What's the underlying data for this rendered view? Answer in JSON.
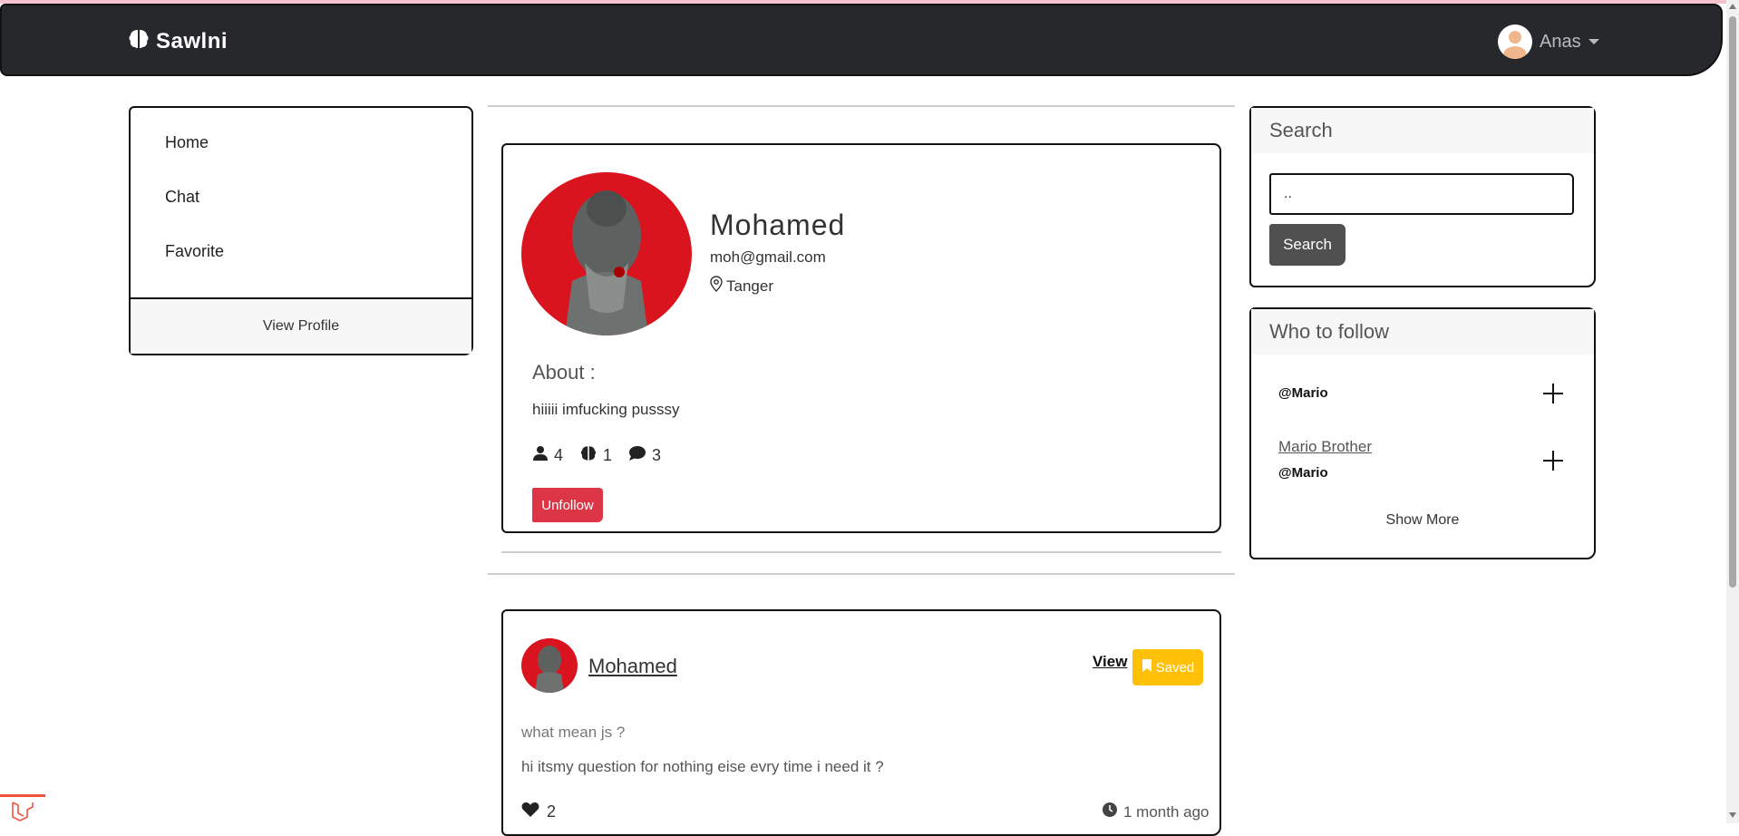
{
  "navbar": {
    "brand": "Sawlni",
    "user_name": "Anas"
  },
  "sidebar": {
    "items": [
      {
        "label": "Home"
      },
      {
        "label": "Chat"
      },
      {
        "label": "Favorite"
      }
    ],
    "footer_link": "View Profile"
  },
  "profile": {
    "name": "Mohamed",
    "email": "moh@gmail.com",
    "location": "Tanger",
    "about_title": "About :",
    "about_text": "hiiiii imfucking pusssy",
    "stats": {
      "followers": "4",
      "posts": "1",
      "comments": "3"
    },
    "action_button": "Unfollow"
  },
  "post": {
    "author": "Mohamed",
    "view_label": "View",
    "saved_label": "Saved",
    "title": "what mean js ?",
    "body": "hi itsmy question for nothing eise evry time i need it ?",
    "likes": "2",
    "time": "1 month ago"
  },
  "search": {
    "title": "Search",
    "input_value": "..",
    "button_label": "Search"
  },
  "who_to_follow": {
    "title": "Who to follow",
    "items": [
      {
        "name": "",
        "handle": "@Mario"
      },
      {
        "name": "Mario Brother",
        "handle": "@Mario"
      }
    ],
    "show_more": "Show More"
  },
  "colors": {
    "navbar_bg": "#26282b",
    "danger": "#dc3545",
    "warning": "#ffc107",
    "search_button": "#505050",
    "avatar_bg": "#d9141f"
  },
  "icons": [
    "brain-icon",
    "user-avatar-icon",
    "caret-down-icon",
    "map-pin-icon",
    "user-icon",
    "brain-icon",
    "comment-icon",
    "bookmark-icon",
    "heart-icon",
    "clock-icon",
    "plus-icon",
    "laravel-icon"
  ]
}
